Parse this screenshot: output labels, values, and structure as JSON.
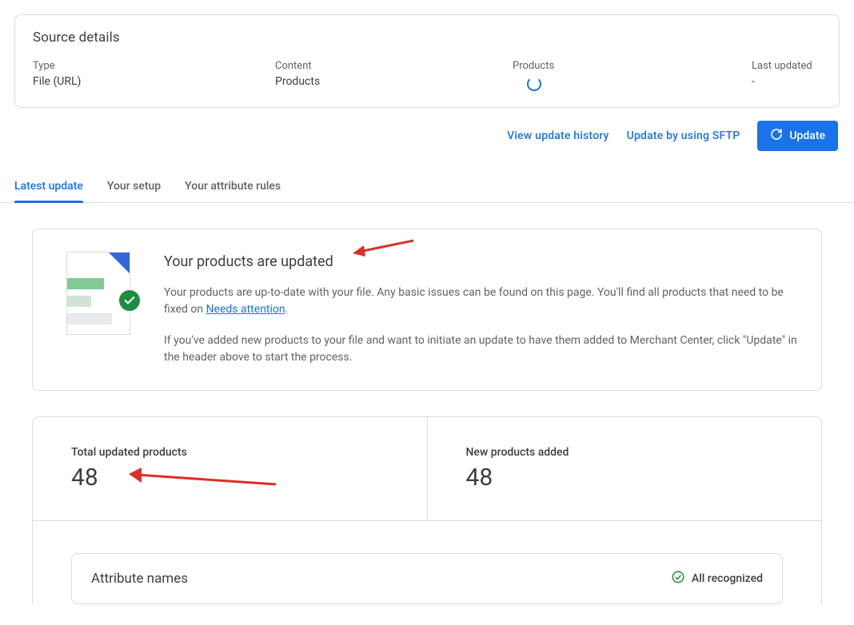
{
  "source": {
    "title": "Source details",
    "type_label": "Type",
    "type_value": "File (URL)",
    "content_label": "Content",
    "content_value": "Products",
    "products_label": "Products",
    "updated_label": "Last updated",
    "updated_value": "-"
  },
  "actions": {
    "history": "View update history",
    "sftp": "Update by using SFTP",
    "update": "Update"
  },
  "tabs": {
    "latest": "Latest update",
    "setup": "Your setup",
    "rules": "Your attribute rules"
  },
  "status": {
    "title": "Your products are updated",
    "p1a": "Your products are up-to-date with your file. Any basic issues can be found on this page. You'll find all products that need to be fixed on ",
    "p1_link": "Needs attention",
    "p1b": ".",
    "p2": "If you've added new products to your file and want to initiate an update to have them added to Merchant Center, click \"Update\" in the header above to start the process."
  },
  "stats": {
    "total_label": "Total updated products",
    "total_value": "48",
    "new_label": "New products added",
    "new_value": "48"
  },
  "attr": {
    "title": "Attribute names",
    "status": "All recognized"
  }
}
